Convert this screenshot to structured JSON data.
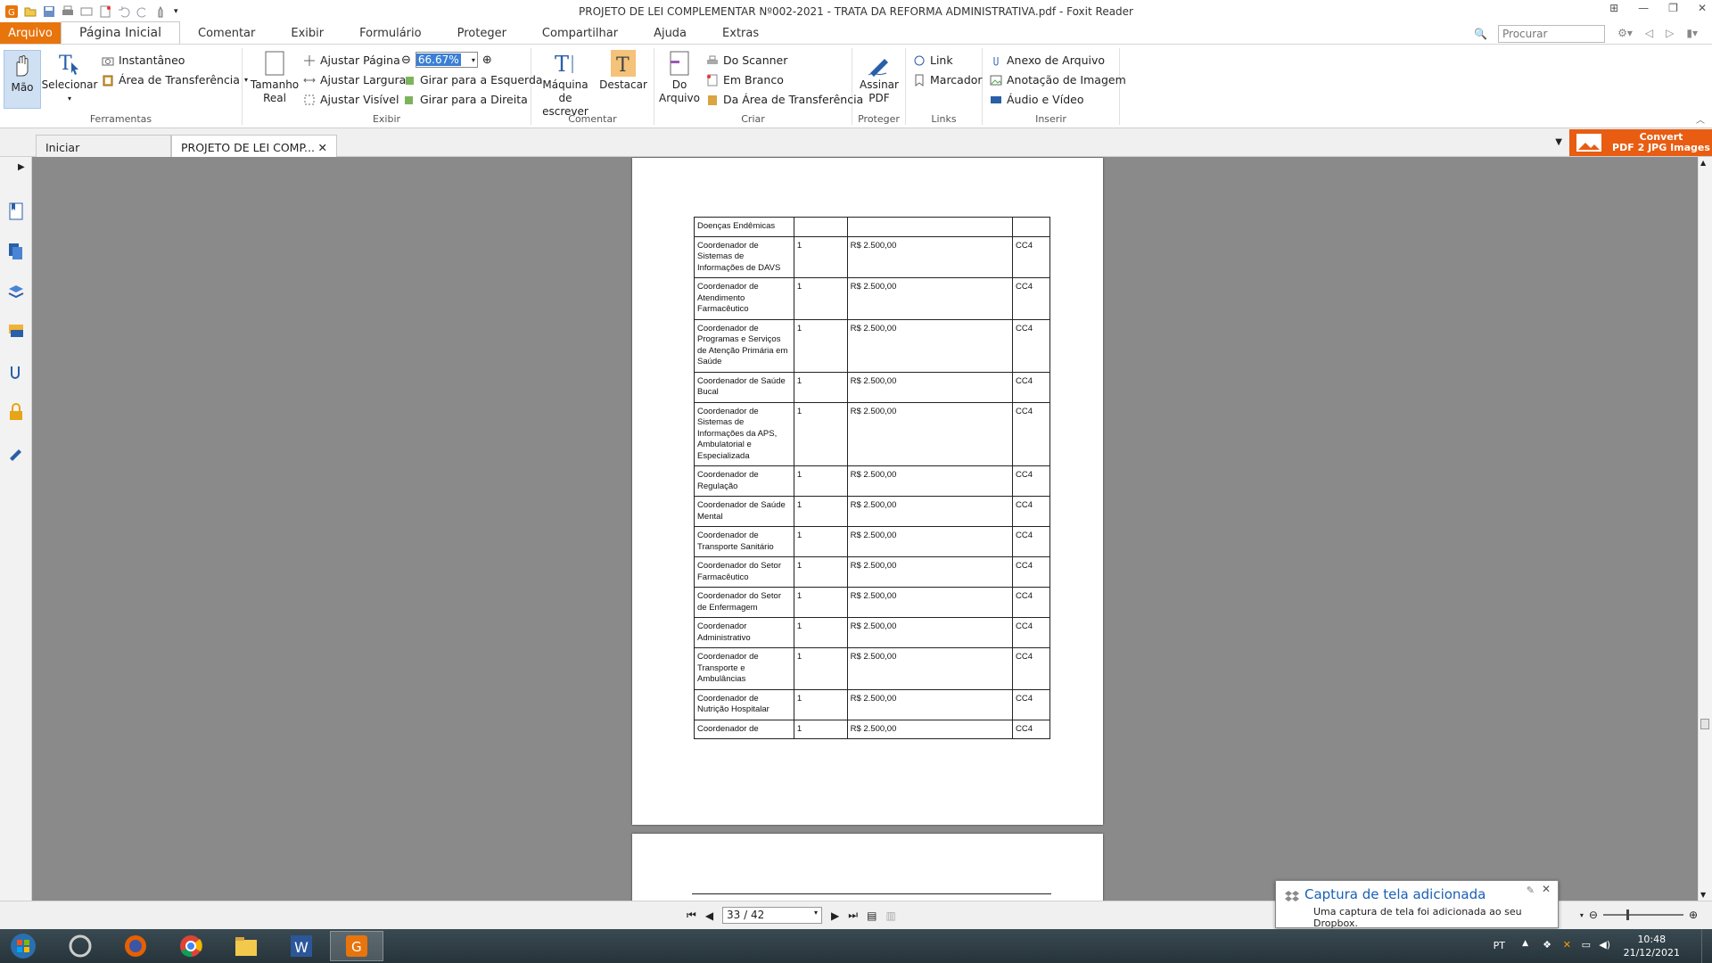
{
  "window": {
    "title": "PROJETO DE LEI COMPLEMENTAR Nº002-2021 - TRATA DA REFORMA ADMINISTRATIVA.pdf - Foxit Reader"
  },
  "menu": {
    "file": "Arquivo",
    "tabs": [
      "Página Inicial",
      "Comentar",
      "Exibir",
      "Formulário",
      "Proteger",
      "Compartilhar",
      "Ajuda",
      "Extras"
    ]
  },
  "search": {
    "placeholder": "Procurar"
  },
  "ribbon": {
    "ferramentas": {
      "label": "Ferramentas",
      "hand": "Mão",
      "select": "Selecionar",
      "snapshot": "Instantâneo",
      "clipboard": "Área de Transferência"
    },
    "exibir": {
      "label": "Exibir",
      "actual_size_1": "Tamanho",
      "actual_size_2": "Real",
      "fit_page": "Ajustar Página",
      "fit_width": "Ajustar Largura",
      "fit_visible": "Ajustar Visível",
      "zoom": "66.67%",
      "rotate_left": "Girar para a Esquerda",
      "rotate_right": "Girar para a Direita"
    },
    "comentar": {
      "label": "Comentar",
      "typewriter_1": "Máquina de",
      "typewriter_2": "escrever",
      "highlight": "Destacar"
    },
    "criar": {
      "label": "Criar",
      "from_file_1": "Do",
      "from_file_2": "Arquivo",
      "scanner": "Do Scanner",
      "blank": "Em Branco",
      "clipboard": "Da Área de Transferência"
    },
    "proteger": {
      "label": "Proteger",
      "sign_1": "Assinar",
      "sign_2": "PDF"
    },
    "links": {
      "label": "Links",
      "link": "Link",
      "bookmark": "Marcador"
    },
    "inserir": {
      "label": "Inserir",
      "attachment": "Anexo de Arquivo",
      "image": "Anotação de Imagem",
      "media": "Áudio e Vídeo"
    }
  },
  "doc_tabs": {
    "start": "Iniciar",
    "current": "PROJETO DE LEI COMP..."
  },
  "convert_ad": {
    "line1": "Convert",
    "line2": "PDF 2 JPG Images"
  },
  "table": {
    "header": "Doenças Endêmicas",
    "rows": [
      {
        "role": "Coordenador de Sistemas de Informações de DAVS",
        "qty": "1",
        "value": "R$ 2.500,00",
        "code": "CC4"
      },
      {
        "role": "Coordenador de Atendimento Farmacêutico",
        "qty": "1",
        "value": "R$ 2.500,00",
        "code": "CC4"
      },
      {
        "role": "Coordenador de Programas e Serviços de Atenção Primária em Saúde",
        "qty": "1",
        "value": "R$ 2.500,00",
        "code": "CC4"
      },
      {
        "role": "Coordenador de Saúde Bucal",
        "qty": "1",
        "value": "R$ 2.500,00",
        "code": "CC4"
      },
      {
        "role": "Coordenador de Sistemas de Informações da APS, Ambulatorial e Especializada",
        "qty": "1",
        "value": "R$ 2.500,00",
        "code": "CC4"
      },
      {
        "role": "Coordenador de Regulação",
        "qty": "1",
        "value": "R$ 2.500,00",
        "code": "CC4"
      },
      {
        "role": "Coordenador de Saúde Mental",
        "qty": "1",
        "value": "R$ 2.500,00",
        "code": "CC4"
      },
      {
        "role": "Coordenador de Transporte Sanitário",
        "qty": "1",
        "value": "R$ 2.500,00",
        "code": "CC4"
      },
      {
        "role": "Coordenador do Setor Farmacêutico",
        "qty": "1",
        "value": "R$ 2.500,00",
        "code": "CC4"
      },
      {
        "role": "Coordenador do Setor de Enfermagem",
        "qty": "1",
        "value": "R$ 2.500,00",
        "code": "CC4"
      },
      {
        "role": "Coordenador Administrativo",
        "qty": "1",
        "value": "R$ 2.500,00",
        "code": "CC4"
      },
      {
        "role": "Coordenador de Transporte e Ambulâncias",
        "qty": "1",
        "value": "R$ 2.500,00",
        "code": "CC4"
      },
      {
        "role": "Coordenador de Nutrição Hospitalar",
        "qty": "1",
        "value": "R$ 2.500,00",
        "code": "CC4"
      },
      {
        "role": "Coordenador de",
        "qty": "1",
        "value": "R$ 2.500,00",
        "code": "CC4"
      }
    ]
  },
  "status": {
    "page": "33 / 42"
  },
  "toast": {
    "title": "Captura de tela adicionada",
    "body": "Uma captura de tela foi adicionada ao seu Dropbox."
  },
  "tray": {
    "lang": "PT",
    "time": "10:48",
    "date": "21/12/2021"
  },
  "colors": {
    "accent": "#e8740c",
    "convert": "#e85d12",
    "link": "#1a5fb4"
  }
}
